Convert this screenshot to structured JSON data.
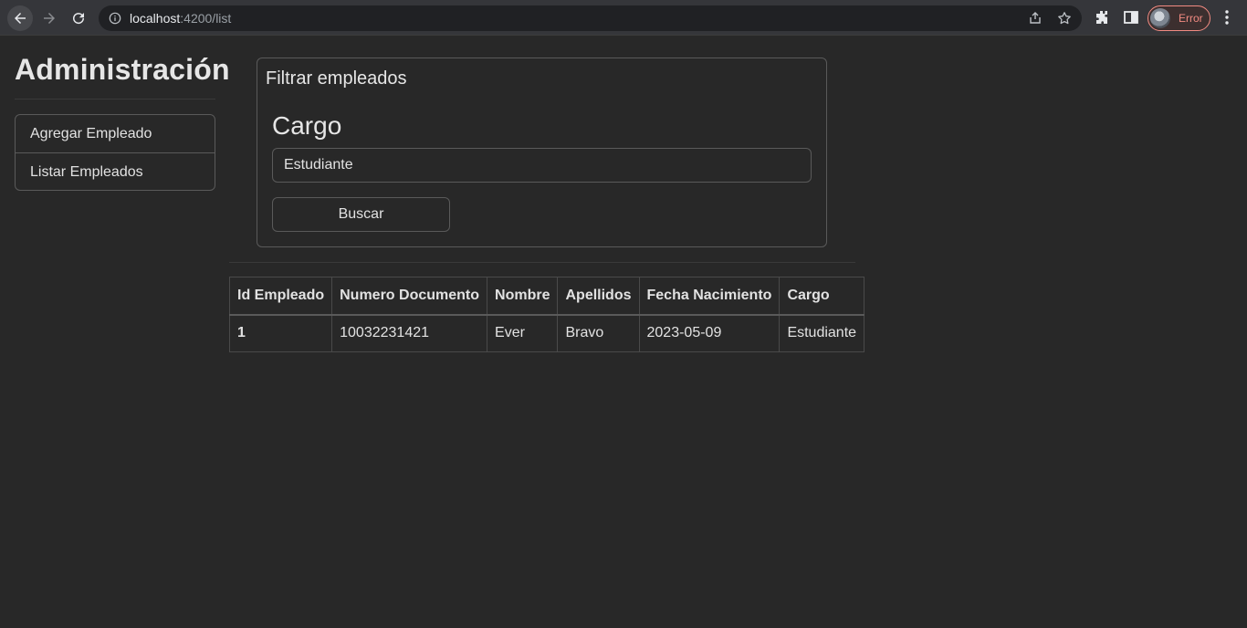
{
  "browser": {
    "url_host": "localhost",
    "url_path": ":4200/list",
    "profile_status": "Error"
  },
  "sidebar": {
    "title": "Administración",
    "items": [
      {
        "label": "Agregar Empleado"
      },
      {
        "label": "Listar Empleados"
      }
    ]
  },
  "filter": {
    "title": "Filtrar empleados",
    "field_label": "Cargo",
    "field_value": "Estudiante",
    "button_label": "Buscar"
  },
  "table": {
    "headers": [
      "Id Empleado",
      "Numero Documento",
      "Nombre",
      "Apellidos",
      "Fecha Nacimiento",
      "Cargo"
    ],
    "rows": [
      [
        "1",
        "10032231421",
        "Ever",
        "Bravo",
        "2023-05-09",
        "Estudiante"
      ]
    ]
  },
  "colors": {
    "background": "#282828",
    "error_accent": "#f28b82"
  }
}
